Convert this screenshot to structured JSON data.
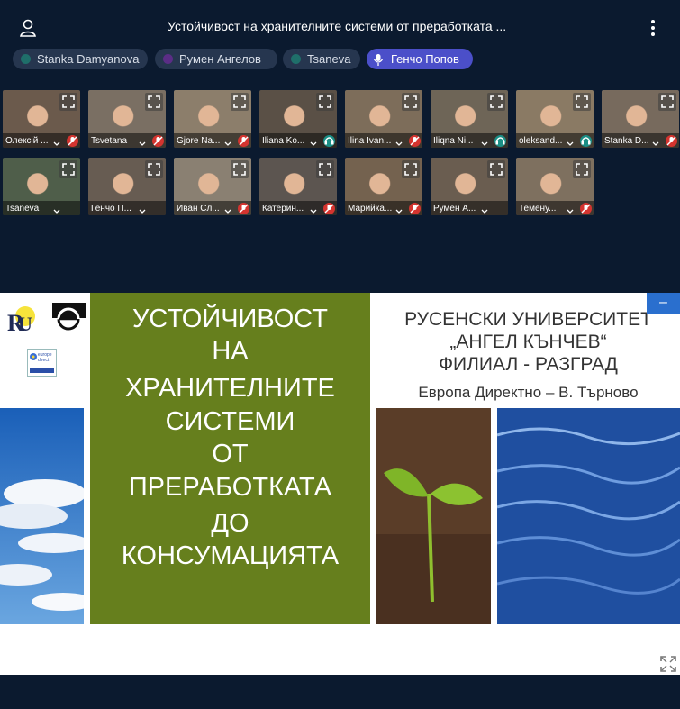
{
  "header": {
    "title": "Устойчивост на хранителните системи от преработката ..."
  },
  "speakers": [
    {
      "name": "Stanka Damyanova",
      "dot": "#1f6f6a",
      "active": false
    },
    {
      "name": "Румен Ангелов",
      "dot": "#5b2d86",
      "active": false
    },
    {
      "name": "Tsaneva",
      "dot": "#1f6f6a",
      "active": false
    },
    {
      "name": "Генчо Попов",
      "dot": "mic",
      "active": true
    }
  ],
  "participants": [
    {
      "name": "Олексій ..."
    },
    {
      "name": "Tsvetana"
    },
    {
      "name": "Gjore Na..."
    },
    {
      "name": "Iliana Ko..."
    },
    {
      "name": "Ilina Ivan..."
    },
    {
      "name": "Iliqna Ni..."
    },
    {
      "name": "oleksand..."
    },
    {
      "name": "Stanka D..."
    },
    {
      "name": "Tsaneva"
    },
    {
      "name": "Генчо П..."
    },
    {
      "name": "Иван Сл..."
    },
    {
      "name": "Катерин..."
    },
    {
      "name": "Марийка..."
    },
    {
      "name": "Румен А..."
    },
    {
      "name": "Темену..."
    }
  ],
  "mic_colors": {
    "muted": "#d4342f",
    "headset": "#1b8f86"
  },
  "slide": {
    "title_lines": [
      "УСТОЙЧИВОСТ",
      "НА",
      "ХРАНИТЕЛНИТЕ",
      "СИСТЕМИ",
      "ОТ",
      "ПРЕРАБОТКАТА",
      "ДО",
      "КОНСУМАЦИЯТА"
    ],
    "university_lines": [
      "РУСЕНСКИ УНИВЕРСИТЕТ",
      "„АНГЕЛ КЪНЧЕВ“",
      "ФИЛИАЛ - РАЗГРАД"
    ],
    "europe_direct": "Европа Директно – В. Търново",
    "logo_europe_direct": "europe direct",
    "minimize_label": "–"
  }
}
